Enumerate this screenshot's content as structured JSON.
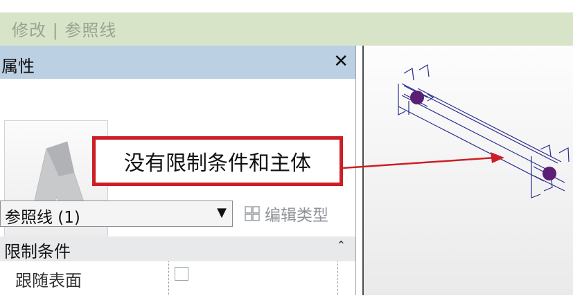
{
  "ribbon": {
    "title": "修改 | 参照线"
  },
  "properties": {
    "title": "属性",
    "close_glyph": "✕",
    "type_selector": {
      "value": "参照线 (1)",
      "arrow": "▼"
    },
    "edit_type_label": "编辑类型",
    "section": {
      "label": "限制条件",
      "collapse_glyph": "⌃"
    },
    "rows": [
      {
        "label": "跟随表面",
        "checked": false
      }
    ]
  },
  "annotation": {
    "text": "没有限制条件和主体",
    "color": "#cc1f25"
  },
  "colors": {
    "ribbon": "#d7e4c8",
    "panel_header": "#bcd0e3",
    "accent_point": "#5b1f73",
    "ref_line": "#2a2d8f"
  },
  "icons": [
    "close-icon",
    "dropdown-arrow-icon",
    "edit-type-icon",
    "collapse-icon",
    "revit-logo-icon"
  ]
}
